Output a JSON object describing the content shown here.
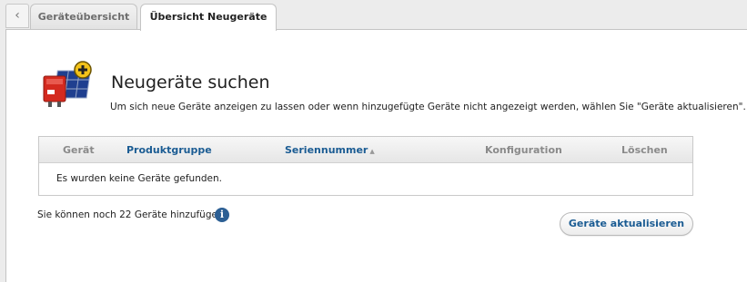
{
  "nav": {
    "back_icon": "chevron-left-icon",
    "back_glyph": "‹",
    "tabs": [
      {
        "label": "Geräteübersicht",
        "active": false
      },
      {
        "label": "Übersicht Neugeräte",
        "active": true
      }
    ]
  },
  "main": {
    "hero_icon": "inverter-with-solar-panel-add-icon",
    "title": "Neugeräte suchen",
    "subtitle": "Um sich neue Geräte anzeigen zu lassen oder wenn hinzugefügte Geräte nicht angezeigt werden, wählen Sie \"Geräte aktualisieren\"."
  },
  "table": {
    "columns": {
      "geraet": "Gerät",
      "produktgruppe": "Produktgruppe",
      "seriennummer": "Seriennummer",
      "konfiguration": "Konfiguration",
      "loeschen": "Löschen"
    },
    "sort_glyph": "▲",
    "empty_message": "Es wurden keine Geräte gefunden."
  },
  "footer": {
    "remaining_text": "Sie können noch 22 Geräte hinzufügen.",
    "info_icon": "info-icon",
    "info_glyph": "i",
    "refresh_label": "Geräte aktualisieren"
  },
  "colors": {
    "accent": "#1b5c93",
    "info": "#2c5f94",
    "inverter_red": "#d42a1f",
    "add_badge": "#f3c21a"
  }
}
